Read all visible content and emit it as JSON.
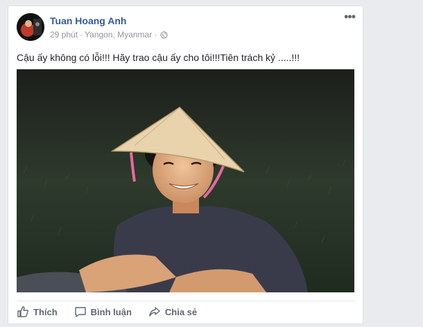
{
  "post": {
    "author": "Tuan Hoang Anh",
    "time": "29 phút",
    "separator": "·",
    "location": "Yangon, Myanmar",
    "separator2": "·",
    "text": "Cậu ấy không có lỗi!!! Hãy trao cậu ấy cho tôi!!!Tiên trách kỷ .....!!!"
  },
  "actions": {
    "like": "Thích",
    "comment": "Bình luận",
    "share": "Chia sẻ"
  },
  "colors": {
    "author": "#365899",
    "meta": "#90949c",
    "action": "#606770"
  }
}
